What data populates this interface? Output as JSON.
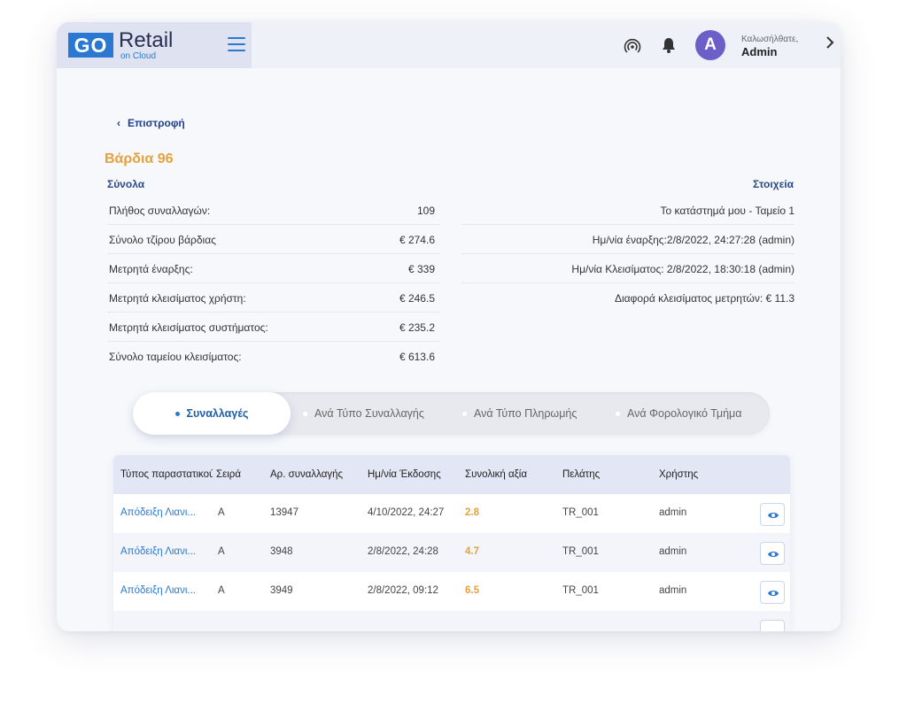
{
  "app": {
    "logo_go": "GO",
    "logo_retail": "Retail",
    "logo_sub": "on Cloud",
    "welcome": "Καλωσήλθατε,",
    "username": "Admin",
    "avatar_letter": "A"
  },
  "colors": {
    "accent": "#2a78d2",
    "title": "#e6a13a",
    "avatar": "#6c5fc7"
  },
  "back_label": "Επιστροφή",
  "shift_title": "Βάρδια 96",
  "totals": {
    "heading": "Σύνολα",
    "rows": [
      {
        "label": "Πλήθος συναλλαγών:",
        "value": "109"
      },
      {
        "label": "Σύνολο τζίρου βάρδιας",
        "value": "€  274.6"
      },
      {
        "label": "Μετρητά έναρξης:",
        "value": "€  339"
      },
      {
        "label": "Μετρητά κλεισίματος χρήστη:",
        "value": "€  246.5"
      },
      {
        "label": "Μετρητά κλεισίματος συστήματος:",
        "value": "€  235.2"
      },
      {
        "label": "Σύνολο ταμείου κλεισίματος:",
        "value": "€  613.6"
      }
    ]
  },
  "details": {
    "heading": "Στοιχεία",
    "rows": [
      "Το κατάστημά μου - Ταμείο 1",
      "Ημ/νία έναρξης:2/8/2022, 24:27:28  (admin)",
      "Ημ/νία Κλεισίματος:  2/8/2022, 18:30:18  (admin)",
      "Διαφορά κλεισίματος μετρητών:   €    11.3"
    ]
  },
  "tabs": [
    {
      "label": "Συναλλαγές"
    },
    {
      "label": "Ανά Τύπο Συναλλαγής"
    },
    {
      "label": "Ανά Τύπο Πληρωμής"
    },
    {
      "label": "Ανά Φορολογικό Τμήμα"
    }
  ],
  "table": {
    "columns": [
      "Τύπος παραστατικού",
      "Σειρά",
      "Αρ. συναλλαγής",
      "Ημ/νία Έκδοσης",
      "Συνολική αξία",
      "Πελάτης",
      "Χρήστης"
    ],
    "rows": [
      {
        "type": "Απόδειξη Λιανι...",
        "series": "A",
        "number": "13947",
        "date": "4/10/2022, 24:27",
        "total": "2.8",
        "customer": "TR_001",
        "user": "admin"
      },
      {
        "type": "Απόδειξη Λιανι...",
        "series": "A",
        "number": "3948",
        "date": "2/8/2022, 24:28",
        "total": "4.7",
        "customer": "TR_001",
        "user": "admin"
      },
      {
        "type": "Απόδειξη Λιανι...",
        "series": "A",
        "number": "3949",
        "date": "2/8/2022, 09:12",
        "total": "6.5",
        "customer": "TR_001",
        "user": "admin"
      }
    ]
  },
  "icons": {
    "menu": "hamburger-icon",
    "connection": "wifi-icon",
    "notifications": "bell-icon",
    "expand": "chevron-right-icon",
    "view": "eye-icon"
  }
}
